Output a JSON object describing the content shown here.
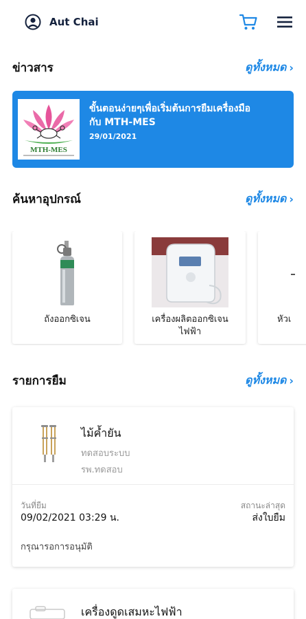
{
  "header": {
    "user_name": "Aut Chai",
    "user_icon": "account-circle-icon",
    "cart_icon": "cart-icon",
    "menu_icon": "hamburger-menu-icon"
  },
  "news": {
    "title": "ข่าวสาร",
    "see_all": "ดูทั้งหมด",
    "items": [
      {
        "logo_text": "MTH-MES",
        "title_line1": "ขั้นตอนง่ายๆเพื่อเริ่มต้นการยืมเครื่องมือ",
        "title_line2": "กับ MTH-MES",
        "date": "29/01/2021"
      }
    ]
  },
  "equipment": {
    "title": "ค้นหาอุปกรณ์",
    "see_all": "ดูทั้งหมด",
    "items": [
      {
        "label": "ถังออกซิเจน",
        "label2": ""
      },
      {
        "label": "เครื่องผลิตออกซิเจน",
        "label2": "ไฟฟ้า"
      },
      {
        "label": "หัวเ",
        "label2": ""
      }
    ]
  },
  "borrow": {
    "title": "รายการยืม",
    "see_all": "ดูทั้งหมด",
    "items": [
      {
        "name": "ไม้ค้ำยัน",
        "sub1": "ทดสอบระบบ",
        "sub2": "รพ.ทดสอบ",
        "date_label": "วันที่ยืม",
        "date_value": "09/02/2021 03:29 น.",
        "status_label": "สถานะล่าสุด",
        "status_value": "ส่งใบยืม",
        "note": "กรุณารอการอนุมัติ"
      },
      {
        "name": "เครื่องดูดเสมหะไฟฟ้า"
      }
    ]
  },
  "colors": {
    "accent": "#1e88e5",
    "dark_navy": "#14213d"
  }
}
